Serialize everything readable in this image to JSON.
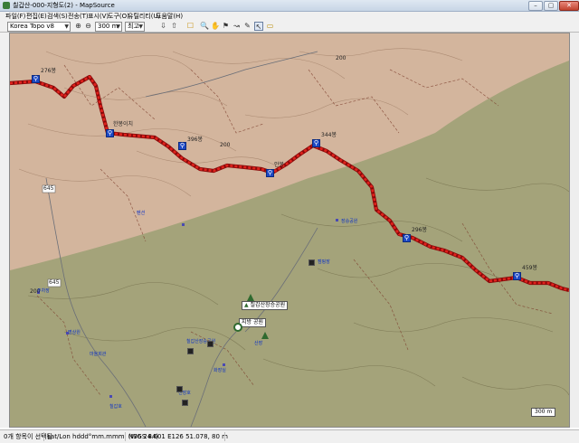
{
  "window": {
    "title": "칠갑산-000-지형도(2) - MapSource",
    "buttons": [
      "–",
      "▢",
      "✕"
    ]
  },
  "menu": [
    "파일(F)",
    "편집(E)",
    "검색(S)",
    "전송(T)",
    "표시(V)",
    "도구(O)",
    "유틸리티(U)",
    "도움말(H)"
  ],
  "toolbar": {
    "product": "Korea Topo v8",
    "scale": "300 m",
    "detail": "최고"
  },
  "map": {
    "contours": [
      "200",
      "200",
      "200"
    ],
    "roads": [
      "645",
      "645"
    ],
    "waypoints": [
      "276봉",
      "한봉이치",
      "396봉",
      "안봉",
      "344봉",
      "296봉",
      "459봉"
    ],
    "callouts": [
      "칠갑산장승공원",
      "지방 공원"
    ],
    "scale_label": "300 m",
    "poi_labels": [
      "장승공원",
      "캠핑장",
      "주차장",
      "명상원",
      "마을회관",
      "화장실",
      "칠갑산장승공원",
      "산장",
      "천장호",
      "칠갑호",
      "펜션"
    ]
  },
  "status": {
    "selection": "0개 항목이 선택됨",
    "format": "Lat/Lon hddd°mm.mmm' (WGS 84)",
    "position": "N36 24.601 E126 51.078, 80 m"
  }
}
